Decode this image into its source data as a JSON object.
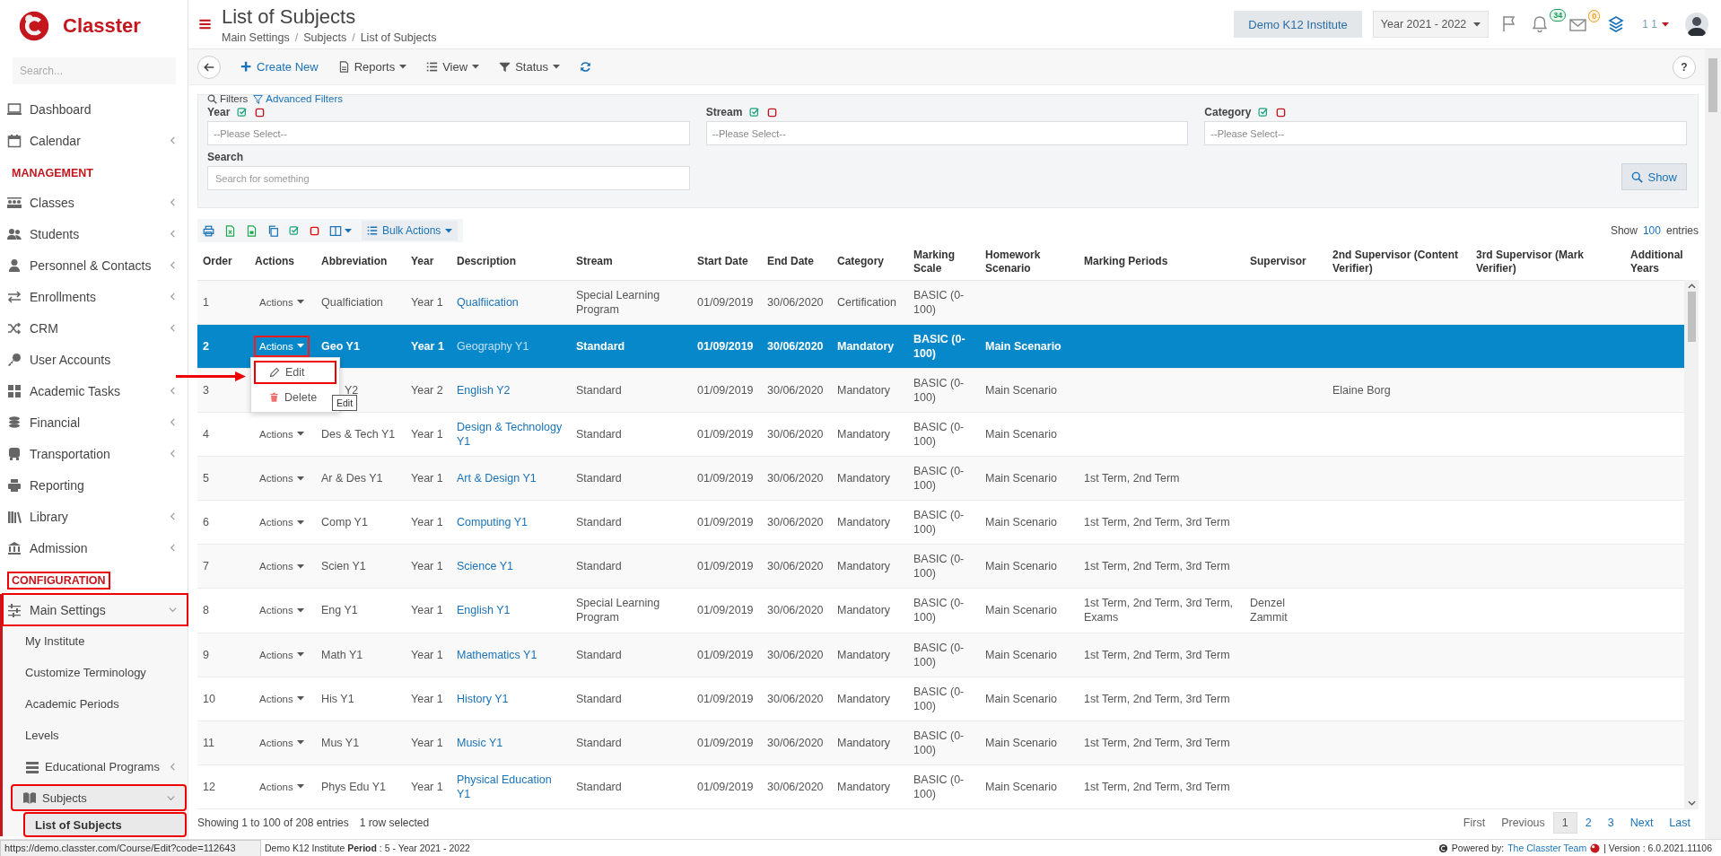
{
  "sidebar": {
    "brand": "Classter",
    "search_placeholder": "Search...",
    "items": [
      {
        "kind": "link",
        "label": "Dashboard",
        "highlighted": false
      },
      {
        "kind": "link",
        "label": "Calendar",
        "expanded": false,
        "highlighted": false
      },
      {
        "kind": "heading",
        "label": "MANAGEMENT",
        "highlighted": false
      },
      {
        "kind": "link",
        "label": "Classes",
        "expanded": false,
        "highlighted": false
      },
      {
        "kind": "link",
        "label": "Students",
        "expanded": false,
        "highlighted": false
      },
      {
        "kind": "link",
        "label": "Personnel & Contacts",
        "expanded": false,
        "highlighted": false
      },
      {
        "kind": "link",
        "label": "Enrollments",
        "expanded": false,
        "highlighted": false
      },
      {
        "kind": "link",
        "label": "CRM",
        "expanded": false,
        "highlighted": false
      },
      {
        "kind": "link",
        "label": "User Accounts",
        "highlighted": false
      },
      {
        "kind": "link",
        "label": "Academic Tasks",
        "expanded": false,
        "highlighted": false
      },
      {
        "kind": "link",
        "label": "Financial",
        "expanded": false,
        "highlighted": false
      },
      {
        "kind": "link",
        "label": "Transportation",
        "expanded": false,
        "highlighted": false
      },
      {
        "kind": "link",
        "label": "Reporting",
        "highlighted": false
      },
      {
        "kind": "link",
        "label": "Library",
        "expanded": false,
        "highlighted": false
      },
      {
        "kind": "link",
        "label": "Admission",
        "expanded": false,
        "highlighted": false
      },
      {
        "kind": "heading",
        "label": "CONFIGURATION",
        "highlighted": true
      },
      {
        "kind": "link",
        "label": "Main Settings",
        "expanded": true,
        "highlighted": true,
        "children": [
          {
            "kind": "link",
            "label": "My Institute",
            "highlighted": false
          },
          {
            "kind": "link",
            "label": "Customize Terminology",
            "highlighted": false
          },
          {
            "kind": "link",
            "label": "Academic Periods",
            "highlighted": false
          },
          {
            "kind": "link",
            "label": "Levels",
            "highlighted": false
          },
          {
            "kind": "link",
            "label": "Educational Programs",
            "expanded": false,
            "highlighted": false
          },
          {
            "kind": "link",
            "label": "Subjects",
            "expanded": true,
            "highlighted": true,
            "children": [
              {
                "kind": "link",
                "label": "List of Subjects",
                "selected": true,
                "highlighted": true
              }
            ]
          }
        ]
      }
    ]
  },
  "header": {
    "title": "List of Subjects",
    "breadcrumb": [
      "Main Settings",
      "Subjects",
      "List of Subjects"
    ],
    "breadcrumb_separator": "/",
    "institute": "Demo K12 Institute",
    "year": "Year 2021 - 2022",
    "notifications": "34",
    "messages": "0",
    "user": "1 1"
  },
  "toolbar": {
    "buttons": [
      "Create New",
      "Reports",
      "View",
      "Status"
    ],
    "help": "?"
  },
  "filters": {
    "tabs": [
      "Filters",
      "Advanced Filters"
    ],
    "fields": [
      {
        "label": "Year",
        "placeholder": "--Please Select--"
      },
      {
        "label": "Stream",
        "placeholder": "--Please Select--"
      },
      {
        "label": "Category",
        "placeholder": "--Please Select--"
      }
    ],
    "search": {
      "label": "Search",
      "placeholder": "Search for something"
    },
    "show_button": "Show"
  },
  "table_tools": {
    "bulk": "Bulk Actions",
    "show_label": "Show",
    "page_size": "100",
    "entries_label": "entries"
  },
  "table": {
    "columns": [
      "Order",
      "Actions",
      "Abbreviation",
      "Year",
      "Description",
      "Stream",
      "Start Date",
      "End Date",
      "Category",
      "Marking Scale",
      "Homework Scenario",
      "Marking Periods",
      "Supervisor",
      "2nd Supervisor (Content Verifier)",
      "3rd Supervisor (Mark Verifier)",
      "Additional Years"
    ],
    "rows": [
      {
        "order": "1",
        "actions": "Actions",
        "actions_highlighted": false,
        "abbreviation": "Qualficiation",
        "year": "Year 1",
        "description": "Qualfiication",
        "stream": "Special Learning Program",
        "start_date": "01/09/2019",
        "end_date": "30/06/2020",
        "category": "Certification",
        "marking_scale": "BASIC (0-100)",
        "selected": false
      },
      {
        "order": "2",
        "actions": "Actions",
        "actions_highlighted": true,
        "abbreviation": "Geo Y1",
        "year": "Year 1",
        "description": "Geography Y1",
        "stream": "Standard",
        "start_date": "01/09/2019",
        "end_date": "30/06/2020",
        "category": "Mandatory",
        "marking_scale": "BASIC (0-100)",
        "homework_scenario": "Main Scenario",
        "selected": true
      },
      {
        "order": "3",
        "abbreviation": "Y2",
        "year": "Year 2",
        "description": "English Y2",
        "stream": "Standard",
        "start_date": "01/09/2019",
        "end_date": "30/06/2020",
        "category": "Mandatory",
        "marking_scale": "BASIC (0-100)",
        "homework_scenario": "Main Scenario",
        "supervisor_2": "Elaine Borg",
        "selected": false
      },
      {
        "order": "4",
        "actions": "Actions",
        "actions_highlighted": false,
        "abbreviation": "Des & Tech Y1",
        "year": "Year 1",
        "description": "Design & Technology Y1",
        "stream": "Standard",
        "start_date": "01/09/2019",
        "end_date": "30/06/2020",
        "category": "Mandatory",
        "marking_scale": "BASIC (0-100)",
        "homework_scenario": "Main Scenario",
        "selected": false
      },
      {
        "order": "5",
        "actions": "Actions",
        "actions_highlighted": false,
        "abbreviation": "Ar & Des Y1",
        "year": "Year 1",
        "description": "Art & Design Y1",
        "stream": "Standard",
        "start_date": "01/09/2019",
        "end_date": "30/06/2020",
        "category": "Mandatory",
        "marking_scale": "BASIC (0-100)",
        "homework_scenario": "Main Scenario",
        "marking_periods": "1st Term, 2nd Term",
        "selected": false
      },
      {
        "order": "6",
        "actions": "Actions",
        "actions_highlighted": false,
        "abbreviation": "Comp Y1",
        "year": "Year 1",
        "description": "Computing Y1",
        "stream": "Standard",
        "start_date": "01/09/2019",
        "end_date": "30/06/2020",
        "category": "Mandatory",
        "marking_scale": "BASIC (0-100)",
        "homework_scenario": "Main Scenario",
        "marking_periods": "1st Term, 2nd Term, 3rd Term",
        "selected": false
      },
      {
        "order": "7",
        "actions": "Actions",
        "actions_highlighted": false,
        "abbreviation": "Scien Y1",
        "year": "Year 1",
        "description": "Science Y1",
        "stream": "Standard",
        "start_date": "01/09/2019",
        "end_date": "30/06/2020",
        "category": "Mandatory",
        "marking_scale": "BASIC (0-100)",
        "homework_scenario": "Main Scenario",
        "marking_periods": "1st Term, 2nd Term, 3rd Term",
        "selected": false
      },
      {
        "order": "8",
        "actions": "Actions",
        "actions_highlighted": false,
        "abbreviation": "Eng Y1",
        "year": "Year 1",
        "description": "English Y1",
        "stream": "Special Learning Program",
        "start_date": "01/09/2019",
        "end_date": "30/06/2020",
        "category": "Mandatory",
        "marking_scale": "BASIC (0-100)",
        "homework_scenario": "Main Scenario",
        "marking_periods": "1st Term, 2nd Term, 3rd Term, Exams",
        "supervisor": "Denzel Zammit",
        "selected": false
      },
      {
        "order": "9",
        "actions": "Actions",
        "actions_highlighted": false,
        "abbreviation": "Math Y1",
        "year": "Year 1",
        "description": "Mathematics Y1",
        "stream": "Standard",
        "start_date": "01/09/2019",
        "end_date": "30/06/2020",
        "category": "Mandatory",
        "marking_scale": "BASIC (0-100)",
        "homework_scenario": "Main Scenario",
        "marking_periods": "1st Term, 2nd Term, 3rd Term",
        "selected": false
      },
      {
        "order": "10",
        "actions": "Actions",
        "actions_highlighted": false,
        "abbreviation": "His Y1",
        "year": "Year 1",
        "description": "History Y1",
        "stream": "Standard",
        "start_date": "01/09/2019",
        "end_date": "30/06/2020",
        "category": "Mandatory",
        "marking_scale": "BASIC (0-100)",
        "homework_scenario": "Main Scenario",
        "marking_periods": "1st Term, 2nd Term, 3rd Term",
        "selected": false
      },
      {
        "order": "11",
        "actions": "Actions",
        "actions_highlighted": false,
        "abbreviation": "Mus Y1",
        "year": "Year 1",
        "description": "Music Y1",
        "stream": "Standard",
        "start_date": "01/09/2019",
        "end_date": "30/06/2020",
        "category": "Mandatory",
        "marking_scale": "BASIC (0-100)",
        "homework_scenario": "Main Scenario",
        "marking_periods": "1st Term, 2nd Term, 3rd Term",
        "selected": false
      },
      {
        "order": "12",
        "actions": "Actions",
        "actions_highlighted": false,
        "abbreviation": "Phys Edu Y1",
        "year": "Year 1",
        "description": "Physical Education Y1",
        "stream": "Standard",
        "start_date": "01/09/2019",
        "end_date": "30/06/2020",
        "category": "Mandatory",
        "marking_scale": "BASIC (0-100)",
        "homework_scenario": "Main Scenario",
        "marking_periods": "1st Term, 2nd Term, 3rd Term",
        "selected": false
      }
    ],
    "menu": {
      "items": [
        {
          "label": "Edit",
          "kind": "edit",
          "highlighted": true
        },
        {
          "label": "Delete",
          "kind": "delete",
          "highlighted": false
        }
      ],
      "tooltip": "Edit"
    }
  },
  "footer": {
    "info": "Showing 1 to 100 of 208 entries",
    "selection": "1 row selected",
    "pages": [
      {
        "label": "First",
        "selected": false
      },
      {
        "label": "Previous",
        "selected": false
      },
      {
        "label": "1",
        "selected": true
      },
      {
        "label": "2",
        "selected": false
      },
      {
        "label": "3",
        "selected": false
      },
      {
        "label": "Next",
        "selected": false
      },
      {
        "label": "Last",
        "selected": false
      }
    ]
  },
  "status_bar": {
    "url": "https://demo.classter.com/Course/Edit?code=112643",
    "text": "Demo K12 Institute **Period** : 5 - Year 2021 - 2022",
    "powered_by": "Powered by:",
    "team": "The Classter Team",
    "version": "| Version : 6.0.2021.11106"
  }
}
